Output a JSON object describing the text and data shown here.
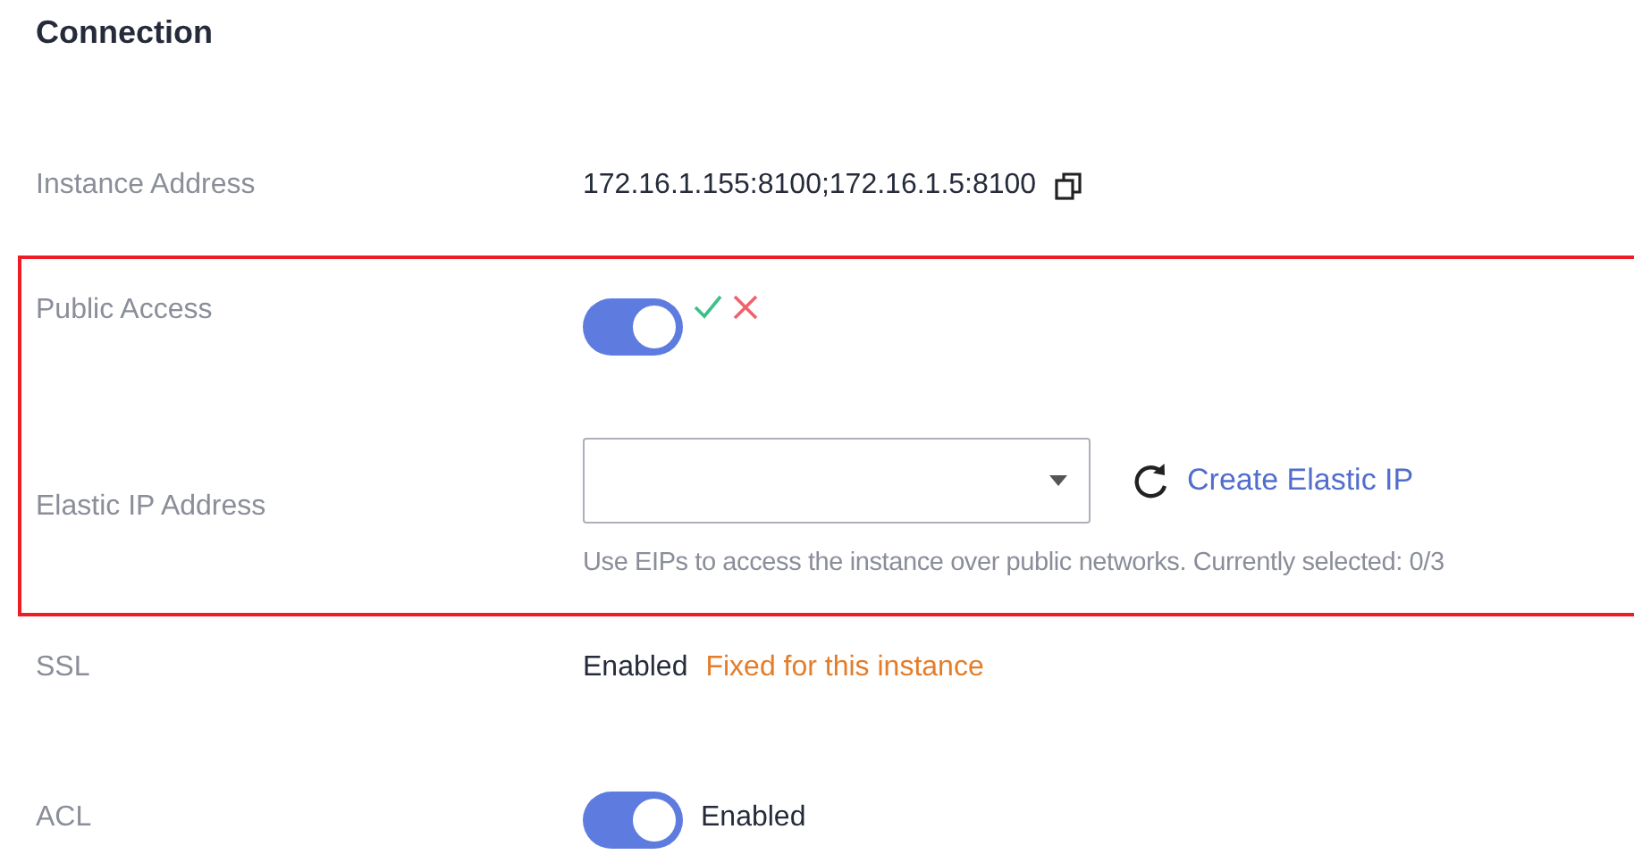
{
  "section_title": "Connection",
  "instance_address": {
    "label": "Instance Address",
    "value": "172.16.1.155:8100;172.16.1.5:8100"
  },
  "public_access": {
    "label": "Public Access",
    "on": true,
    "highlighted": true
  },
  "elastic_ip": {
    "label": "Elastic IP Address",
    "link": "Create Elastic IP",
    "hint": "Use EIPs to access the instance over public networks. Currently selected: 0/3"
  },
  "ssl": {
    "label": "SSL",
    "value": "Enabled",
    "note": "Fixed for this instance"
  },
  "acl": {
    "label": "ACL",
    "on": true,
    "value": "Enabled"
  }
}
